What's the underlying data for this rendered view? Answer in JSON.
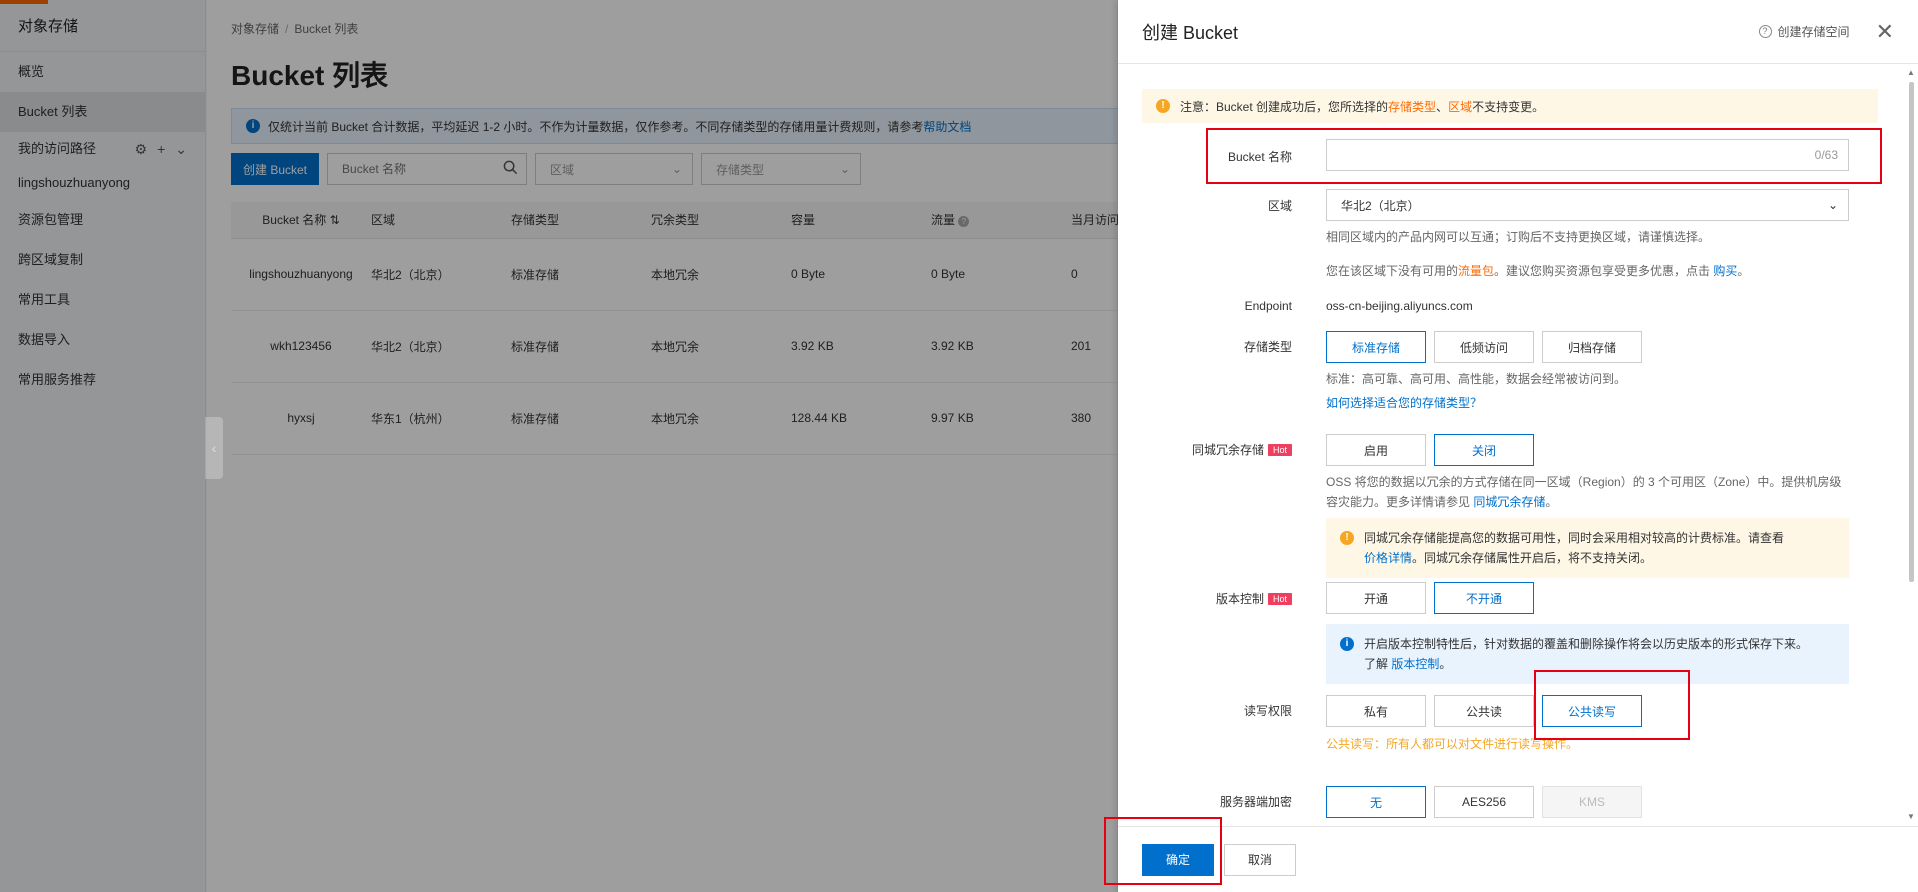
{
  "sidebar": {
    "title": "对象存储",
    "items": [
      {
        "label": "概览"
      },
      {
        "label": "Bucket 列表"
      }
    ],
    "access_path": {
      "label": "我的访问路径",
      "sub": "lingshouzhuanyong"
    },
    "more": [
      {
        "label": "资源包管理"
      },
      {
        "label": "跨区域复制"
      },
      {
        "label": "常用工具"
      },
      {
        "label": "数据导入"
      },
      {
        "label": "常用服务推荐"
      }
    ]
  },
  "main": {
    "breadcrumb": [
      "对象存储",
      "Bucket 列表"
    ],
    "title": "Bucket 列表",
    "notice": "仅统计当前 Bucket 合计数据，平均延迟 1-2 小时。不作为计量数据，仅作参考。不同存储类型的存储用量计费规则，请参考",
    "notice_link": "帮助文档",
    "create_button": "创建 Bucket",
    "search_placeholder": "Bucket 名称",
    "region_filter": "区域",
    "storage_filter": "存储类型",
    "table": {
      "headers": [
        "Bucket 名称",
        "区域",
        "存储类型",
        "冗余类型",
        "容量",
        "流量",
        "当月访问"
      ],
      "rows": [
        [
          "lingshouzhuanyong",
          "华北2（北京）",
          "标准存储",
          "本地冗余",
          "0 Byte",
          "0 Byte",
          "0"
        ],
        [
          "wkh123456",
          "华北2（北京）",
          "标准存储",
          "本地冗余",
          "3.92 KB",
          "3.92 KB",
          "201"
        ],
        [
          "hyxsj",
          "华东1（杭州）",
          "标准存储",
          "本地冗余",
          "128.44 KB",
          "9.97 KB",
          "380"
        ]
      ]
    }
  },
  "drawer": {
    "title": "创建 Bucket",
    "help_link": "创建存储空间",
    "warning": {
      "prefix": "注意：Bucket 创建成功后，您所选择的",
      "em1": "存储类型",
      "sep": "、",
      "em2": "区域",
      "suffix": "不支持变更。"
    },
    "name": {
      "label": "Bucket 名称",
      "counter": "0/63"
    },
    "region": {
      "label": "区域",
      "value": "华北2（北京）",
      "hint1": "相同区域内的产品内网可以互通；订购后不支持更换区域，请谨慎选择。",
      "hint2_prefix": "您在该区域下没有可用的",
      "hint2_em": "流量包",
      "hint2_middle": "。建议您购买资源包享受更多优惠，点击",
      "hint2_link": "购买",
      "hint2_suffix": "。"
    },
    "endpoint": {
      "label": "Endpoint",
      "value": "oss-cn-beijing.aliyuncs.com"
    },
    "storage_class": {
      "label": "存储类型",
      "options": [
        "标准存储",
        "低频访问",
        "归档存储"
      ],
      "hint": "标准：高可靠、高可用、高性能，数据会经常被访问到。",
      "link": "如何选择适合您的存储类型？"
    },
    "zrs": {
      "label": "同城冗余存储",
      "badge": "Hot",
      "options": [
        "启用",
        "关闭"
      ],
      "hint": "OSS 将您的数据以冗余的方式存储在同一区域（Region）的 3 个可用区（Zone）中。提供机房级容灾能力。更多详情请参见",
      "hint_link": "同城冗余存储",
      "hint_suffix": "。",
      "box_text": "同城冗余存储能提高您的数据可用性，同时会采用相对较高的计费标准。请查看",
      "box_link": "价格详情",
      "box_suffix": "。同城冗余存储属性开启后，将不支持关闭。"
    },
    "versioning": {
      "label": "版本控制",
      "badge": "Hot",
      "options": [
        "开通",
        "不开通"
      ],
      "box_text": "开启版本控制特性后，针对数据的覆盖和删除操作将会以历史版本的形式保存下来。",
      "box_prefix": "了解",
      "box_link": "版本控制",
      "box_suffix": "。"
    },
    "acl": {
      "label": "读写权限",
      "options": [
        "私有",
        "公共读",
        "公共读写"
      ],
      "warning": "公共读写：所有人都可以对文件进行读写操作。"
    },
    "encryption": {
      "label": "服务器端加密",
      "options": [
        "无",
        "AES256",
        "KMS"
      ]
    },
    "ok": "确定",
    "cancel": "取消"
  },
  "colors": {
    "primary": "#0070cc",
    "orange": "#ff6a00",
    "hot": "#ee3f60",
    "annotation": "#e60012"
  }
}
